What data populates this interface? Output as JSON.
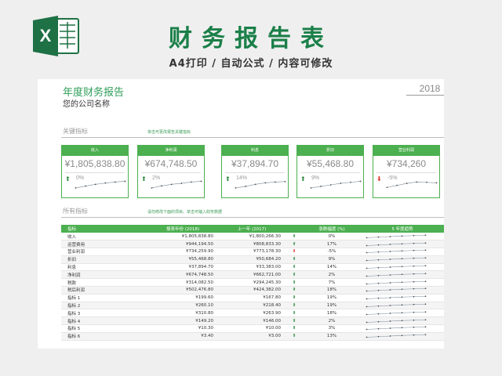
{
  "banner": {
    "title": "财务报告表",
    "subtitle": "A4打印 / 自动公式 / 内容可修改",
    "logo_letter": "X",
    "logo_icon": "excel-icon"
  },
  "report": {
    "title": "年度财务报告",
    "company": "您的公司名称",
    "year": "2018"
  },
  "kpi_section": {
    "label": "关键指标",
    "note": "单击可更改报告关键指标"
  },
  "kpis": [
    {
      "label": "收入",
      "value": "¥1,805,838.80",
      "pct": "0%",
      "dir": "up",
      "trend": [
        0.2,
        0.38,
        0.55,
        0.68,
        0.78,
        0.85
      ]
    },
    {
      "label": "净利润",
      "value": "¥674,748.50",
      "pct": "2%",
      "dir": "up",
      "trend": [
        0.2,
        0.4,
        0.55,
        0.65,
        0.78,
        0.85
      ]
    },
    {
      "label": "利息",
      "value": "¥37,894.70",
      "pct": "14%",
      "dir": "up",
      "trend": [
        0.2,
        0.35,
        0.55,
        0.7,
        0.78,
        0.82
      ]
    },
    {
      "label": "折旧",
      "value": "¥55,468.80",
      "pct": "9%",
      "dir": "up",
      "trend": [
        0.2,
        0.35,
        0.5,
        0.65,
        0.75,
        0.85
      ]
    },
    {
      "label": "营业利润",
      "value": "¥734,260",
      "pct": "-5%",
      "dir": "down",
      "trend": [
        0.25,
        0.45,
        0.65,
        0.78,
        0.75,
        0.7
      ]
    }
  ],
  "all_section": {
    "label": "所有指标",
    "note": "请勿修改下面的项目。单击可输入财务数据"
  },
  "table": {
    "headers": [
      "指标",
      "报表年份 (2018)",
      "上一年 (2017)",
      "",
      "涨跌幅度 (%)",
      "5 年度趋势"
    ],
    "rows": [
      {
        "name": "收入",
        "cur": "¥1,805,838.80",
        "prev": "¥1,800,266.30",
        "dir": "up",
        "pct": "0%",
        "trend": [
          0.2,
          0.35,
          0.5,
          0.65,
          0.75,
          0.85
        ]
      },
      {
        "name": "运营费用",
        "cur": "¥944,194.50",
        "prev": "¥808,833.30",
        "dir": "up",
        "pct": "17%",
        "trend": [
          0.2,
          0.35,
          0.5,
          0.65,
          0.75,
          0.85
        ]
      },
      {
        "name": "营业利润",
        "cur": "¥734,259.90",
        "prev": "¥773,178.30",
        "dir": "down",
        "pct": "-5%",
        "trend": [
          0.2,
          0.35,
          0.5,
          0.65,
          0.75,
          0.85
        ]
      },
      {
        "name": "折旧",
        "cur": "¥55,468.80",
        "prev": "¥50,684.20",
        "dir": "up",
        "pct": "9%",
        "trend": [
          0.2,
          0.35,
          0.5,
          0.65,
          0.75,
          0.85
        ]
      },
      {
        "name": "利息",
        "cur": "¥37,894.70",
        "prev": "¥33,383.00",
        "dir": "up",
        "pct": "14%",
        "trend": [
          0.2,
          0.35,
          0.5,
          0.65,
          0.75,
          0.85
        ]
      },
      {
        "name": "净利润",
        "cur": "¥674,748.50",
        "prev": "¥662,721.00",
        "dir": "up",
        "pct": "2%",
        "trend": [
          0.2,
          0.35,
          0.5,
          0.65,
          0.75,
          0.85
        ]
      },
      {
        "name": "税款",
        "cur": "¥314,082.50",
        "prev": "¥294,245.30",
        "dir": "up",
        "pct": "7%",
        "trend": [
          0.2,
          0.35,
          0.5,
          0.65,
          0.75,
          0.85
        ]
      },
      {
        "name": "税后利润",
        "cur": "¥502,476.80",
        "prev": "¥424,382.00",
        "dir": "up",
        "pct": "18%",
        "trend": [
          0.2,
          0.35,
          0.5,
          0.65,
          0.75,
          0.85
        ]
      },
      {
        "name": "指标 1",
        "cur": "¥199.60",
        "prev": "¥167.80",
        "dir": "up",
        "pct": "19%",
        "trend": [
          0.2,
          0.35,
          0.5,
          0.65,
          0.75,
          0.85
        ]
      },
      {
        "name": "指标 2",
        "cur": "¥260.10",
        "prev": "¥218.40",
        "dir": "up",
        "pct": "19%",
        "trend": [
          0.2,
          0.35,
          0.5,
          0.65,
          0.75,
          0.85
        ]
      },
      {
        "name": "指标 3",
        "cur": "¥310.80",
        "prev": "¥263.90",
        "dir": "up",
        "pct": "18%",
        "trend": [
          0.2,
          0.35,
          0.5,
          0.65,
          0.75,
          0.85
        ]
      },
      {
        "name": "指标 4",
        "cur": "¥149.20",
        "prev": "¥146.00",
        "dir": "up",
        "pct": "2%",
        "trend": [
          0.2,
          0.35,
          0.5,
          0.65,
          0.75,
          0.85
        ]
      },
      {
        "name": "指标 5",
        "cur": "¥10.30",
        "prev": "¥10.00",
        "dir": "up",
        "pct": "3%",
        "trend": [
          0.2,
          0.35,
          0.5,
          0.65,
          0.75,
          0.85
        ]
      },
      {
        "name": "指标 6",
        "cur": "¥3.40",
        "prev": "¥3.00",
        "dir": "up",
        "pct": "13%",
        "trend": [
          0.2,
          0.35,
          0.5,
          0.65,
          0.75,
          0.85
        ]
      }
    ]
  },
  "colors": {
    "accent": "#4caf50",
    "title_green": "#1a7f48",
    "up": "#2e8b3e",
    "down": "#d9372b"
  }
}
